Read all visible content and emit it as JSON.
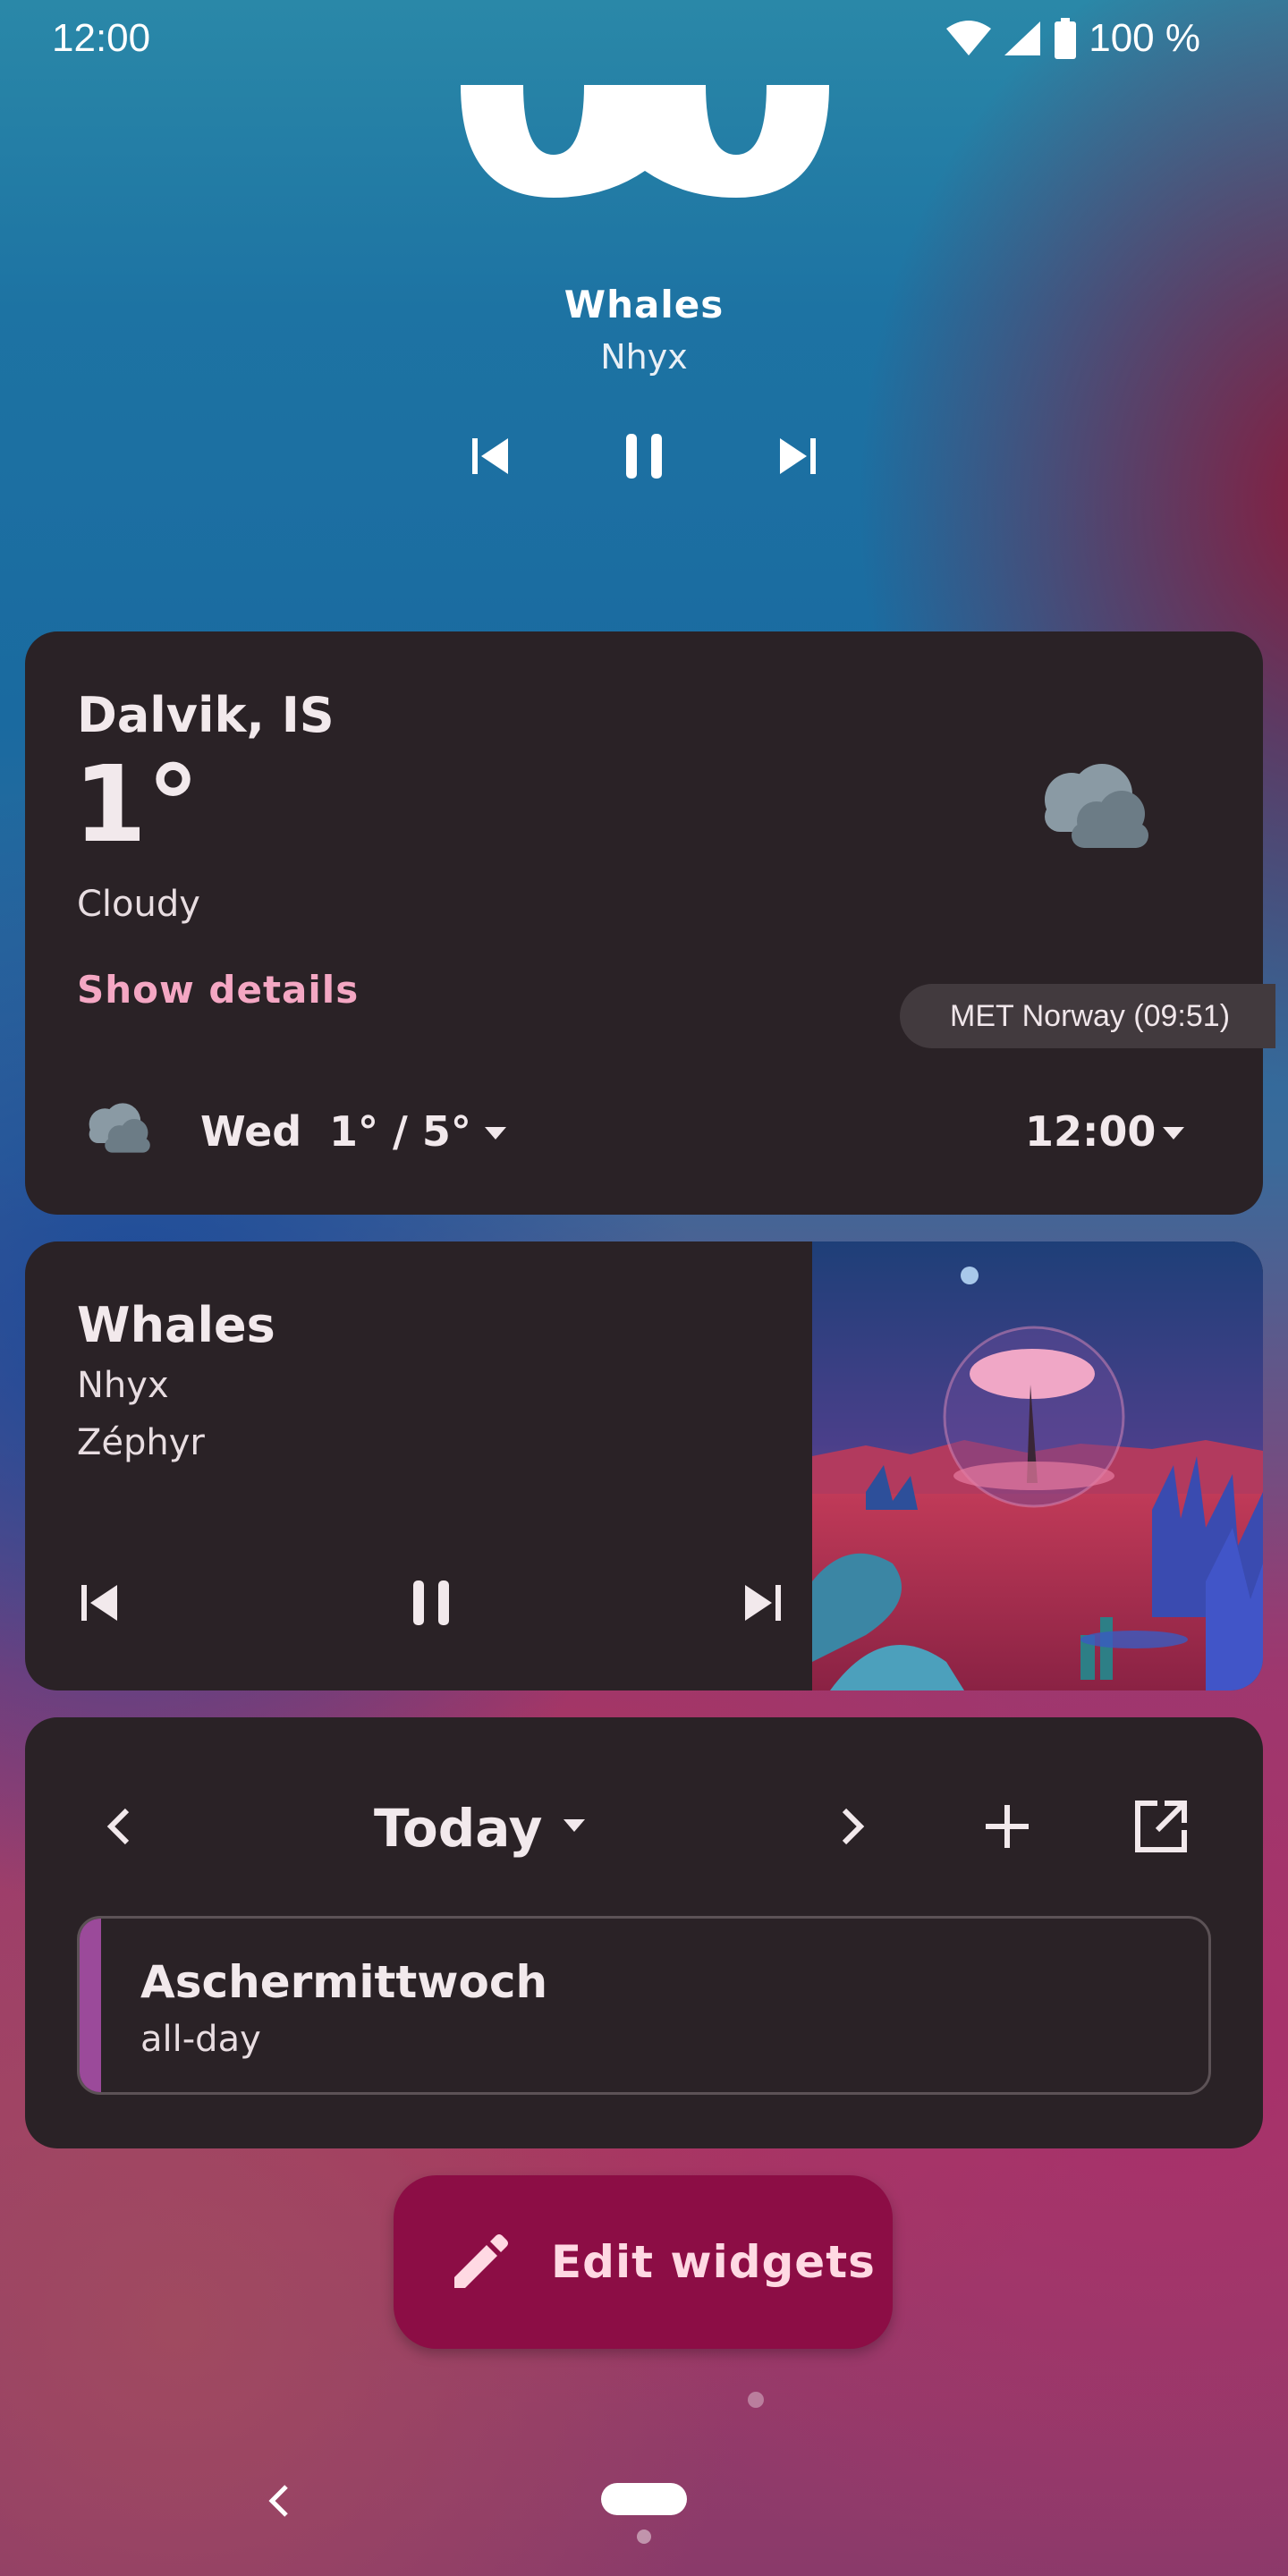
{
  "status_bar": {
    "time": "12:00",
    "battery": "100 %"
  },
  "top_media": {
    "title": "Whales",
    "artist": "Nhyx"
  },
  "weather": {
    "location": "Dalvik, IS",
    "temperature": "1°",
    "condition": "Cloudy",
    "details_label": "Show details",
    "source": "MET Norway (09:51)",
    "forecast_day": "Wed",
    "forecast_range": "1° / 5°",
    "forecast_time": "12:00"
  },
  "music": {
    "title": "Whales",
    "artist": "Nhyx",
    "album": "Zéphyr"
  },
  "calendar": {
    "range_label": "Today",
    "event": {
      "title": "Aschermittwoch",
      "time": "all-day",
      "color": "#9b4a9a"
    }
  },
  "fab": {
    "label": "Edit widgets",
    "color": "#8c0d45"
  },
  "icons": [
    "wifi-icon",
    "signal-icon",
    "battery-icon",
    "skip-previous-icon",
    "pause-icon",
    "skip-next-icon",
    "cloud-icon",
    "chevron-left-icon",
    "chevron-right-icon",
    "plus-icon",
    "open-external-icon",
    "pencil-icon",
    "caret-down-icon"
  ]
}
